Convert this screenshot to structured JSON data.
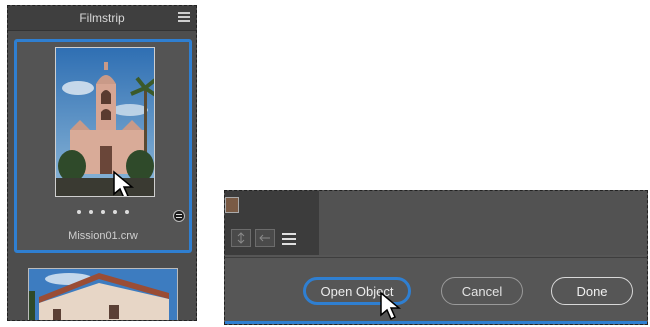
{
  "filmstrip": {
    "title": "Filmstrip",
    "menu_icon": "hamburger-menu-icon",
    "selected_file": "Mission01.crw",
    "dot_count": 5,
    "badge_icon": "adjustments-badge-icon",
    "accent": "#2f7fd1"
  },
  "dialog": {
    "toolbar_icons": [
      "fit-vertical-icon",
      "flip-icon",
      "sliders-icon"
    ],
    "buttons": {
      "open_object": "Open Object",
      "cancel": "Cancel",
      "done": "Done"
    }
  }
}
